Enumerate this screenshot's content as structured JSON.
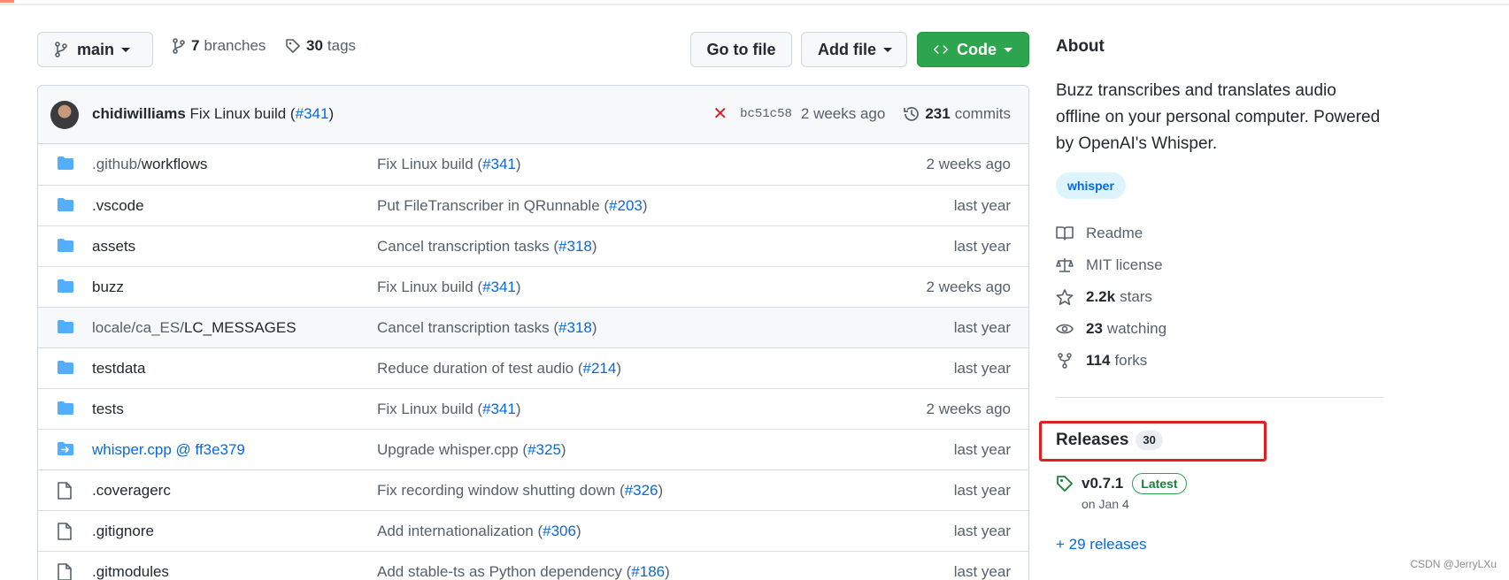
{
  "toolbar": {
    "branch_label": "main",
    "branches_count": "7",
    "branches_label": "branches",
    "tags_count": "30",
    "tags_label": "tags",
    "goto_file_label": "Go to file",
    "add_file_label": "Add file",
    "code_label": "Code"
  },
  "commit": {
    "author": "chidiwilliams",
    "message": "Fix Linux build (",
    "pr": "#341",
    "close": ")",
    "sha": "bc51c58",
    "time": "2 weeks ago",
    "commits_count": "231",
    "commits_label": "commits"
  },
  "files": [
    {
      "name_parts": [
        ".github/",
        "workflows"
      ],
      "type": "folder",
      "msg": "Fix Linux build (",
      "pr": "#341",
      "date": "2 weeks ago"
    },
    {
      "name_parts": [
        ".vscode"
      ],
      "type": "folder",
      "msg": "Put FileTranscriber in QRunnable (",
      "pr": "#203",
      "date": "last year"
    },
    {
      "name_parts": [
        "assets"
      ],
      "type": "folder",
      "msg": "Cancel transcription tasks (",
      "pr": "#318",
      "date": "last year"
    },
    {
      "name_parts": [
        "buzz"
      ],
      "type": "folder",
      "msg": "Fix Linux build (",
      "pr": "#341",
      "date": "2 weeks ago"
    },
    {
      "name_parts": [
        "locale/ca_ES/",
        "LC_MESSAGES"
      ],
      "type": "folder",
      "msg": "Cancel transcription tasks (",
      "pr": "#318",
      "date": "last year"
    },
    {
      "name_parts": [
        "testdata"
      ],
      "type": "folder",
      "msg": "Reduce duration of test audio (",
      "pr": "#214",
      "date": "last year"
    },
    {
      "name_parts": [
        "tests"
      ],
      "type": "folder",
      "msg": "Fix Linux build (",
      "pr": "#341",
      "date": "2 weeks ago"
    },
    {
      "name_parts": [
        "whisper.cpp @ ff3e379"
      ],
      "type": "submodule",
      "msg": "Upgrade whisper.cpp (",
      "pr": "#325",
      "date": "last year"
    },
    {
      "name_parts": [
        ".coveragerc"
      ],
      "type": "file",
      "msg": "Fix recording window shutting down (",
      "pr": "#326",
      "date": "last year"
    },
    {
      "name_parts": [
        ".gitignore"
      ],
      "type": "file",
      "msg": "Add internationalization (",
      "pr": "#306",
      "date": "last year"
    },
    {
      "name_parts": [
        ".gitmodules"
      ],
      "type": "file",
      "msg": "Add stable-ts as Python dependency (",
      "pr": "#186",
      "date": "last year"
    }
  ],
  "about": {
    "title": "About",
    "description": "Buzz transcribes and translates audio offline on your personal computer. Powered by OpenAI's Whisper.",
    "topic": "whisper",
    "readme": "Readme",
    "license": "MIT license",
    "stars_count": "2.2k",
    "stars_label": "stars",
    "watching_count": "23",
    "watching_label": "watching",
    "forks_count": "114",
    "forks_label": "forks"
  },
  "releases": {
    "title": "Releases",
    "count": "30",
    "version": "v0.7.1",
    "latest_label": "Latest",
    "date": "on Jan 4",
    "more": "+ 29 releases"
  },
  "watermark": "CSDN @JerryLXu",
  "colors": {
    "accent": "#0969da",
    "green": "#2da44e",
    "highlight_border": "#e02020",
    "folder": "#54aeff"
  }
}
